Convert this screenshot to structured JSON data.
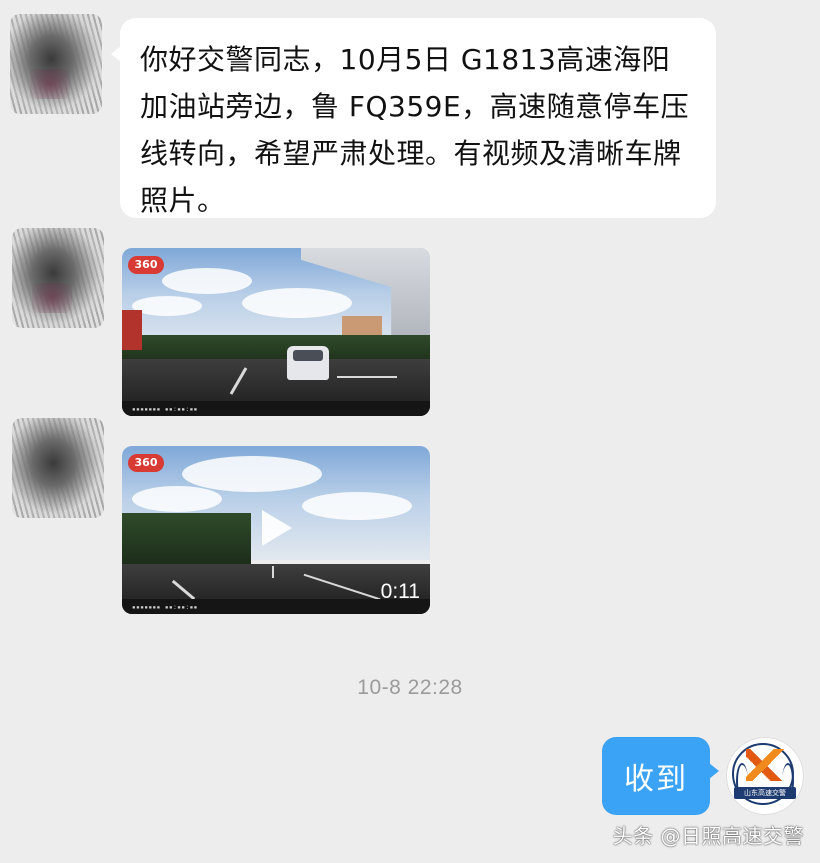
{
  "chat": {
    "incoming_message": "你好交警同志，10月5日 G1813高速海阳加油站旁边，鲁 FQ359E，高速随意停车压线转向，希望严肃处理。有视频及清晰车牌照片。",
    "media": [
      {
        "type": "photo",
        "badge": "360"
      },
      {
        "type": "video",
        "badge": "360",
        "duration": "0:11"
      }
    ],
    "timestamp": "10-8 22:28",
    "outgoing_message": "收到"
  },
  "profile": {
    "logo_caption": "山东高速交警"
  },
  "watermark": "头条 @日照高速交警",
  "colors": {
    "background": "#ededed",
    "incoming_bubble": "#ffffff",
    "outgoing_bubble": "#3ba3f5",
    "badge": "#d83a34"
  }
}
